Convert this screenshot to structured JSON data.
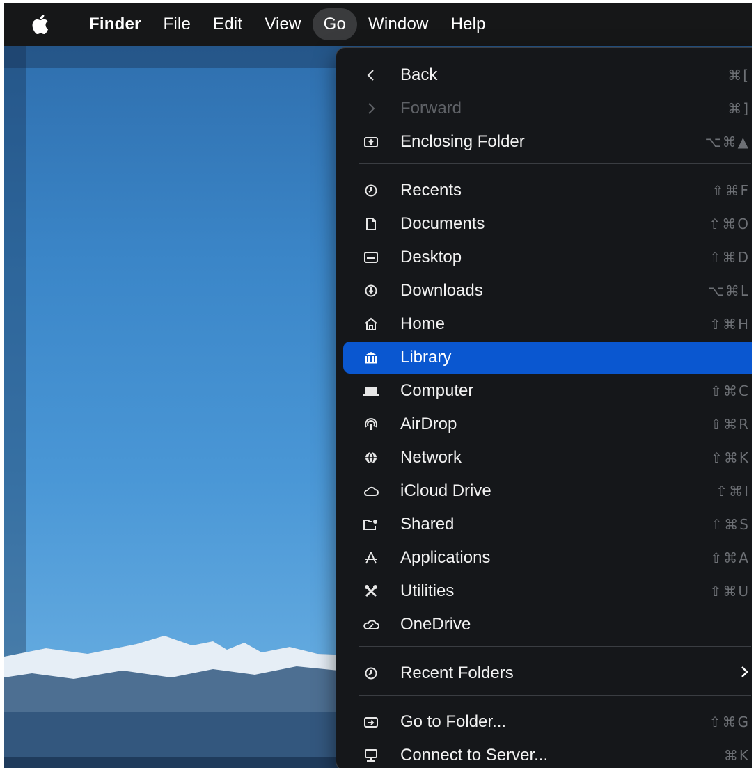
{
  "menubar": {
    "apple_icon": "apple-logo",
    "items": [
      "Finder",
      "File",
      "Edit",
      "View",
      "Go",
      "Window",
      "Help"
    ],
    "active": "Go"
  },
  "go_menu": {
    "items": [
      {
        "label": "Back",
        "icon": "chevron-left-icon",
        "shortcut": "⌘[",
        "enabled": true
      },
      {
        "label": "Forward",
        "icon": "chevron-right-icon",
        "shortcut": "⌘]",
        "enabled": false
      },
      {
        "label": "Enclosing Folder",
        "icon": "enclosing-folder-icon",
        "shortcut": "⌥⌘▲",
        "enabled": true
      },
      {
        "label": "Recents",
        "icon": "clock-icon",
        "shortcut": "⇧⌘F",
        "enabled": true
      },
      {
        "label": "Documents",
        "icon": "document-icon",
        "shortcut": "⇧⌘O",
        "enabled": true
      },
      {
        "label": "Desktop",
        "icon": "desktop-icon",
        "shortcut": "⇧⌘D",
        "enabled": true
      },
      {
        "label": "Downloads",
        "icon": "download-icon",
        "shortcut": "⌥⌘L",
        "enabled": true
      },
      {
        "label": "Home",
        "icon": "home-icon",
        "shortcut": "⇧⌘H",
        "enabled": true
      },
      {
        "label": "Library",
        "icon": "library-icon",
        "shortcut": "",
        "enabled": true,
        "highlighted": true
      },
      {
        "label": "Computer",
        "icon": "laptop-icon",
        "shortcut": "⇧⌘C",
        "enabled": true
      },
      {
        "label": "AirDrop",
        "icon": "airdrop-icon",
        "shortcut": "⇧⌘R",
        "enabled": true
      },
      {
        "label": "Network",
        "icon": "globe-icon",
        "shortcut": "⇧⌘K",
        "enabled": true
      },
      {
        "label": "iCloud Drive",
        "icon": "cloud-icon",
        "shortcut": "⇧⌘I",
        "enabled": true
      },
      {
        "label": "Shared",
        "icon": "shared-folder-icon",
        "shortcut": "⇧⌘S",
        "enabled": true
      },
      {
        "label": "Applications",
        "icon": "applications-icon",
        "shortcut": "⇧⌘A",
        "enabled": true
      },
      {
        "label": "Utilities",
        "icon": "utilities-icon",
        "shortcut": "⇧⌘U",
        "enabled": true
      },
      {
        "label": "OneDrive",
        "icon": "onedrive-icon",
        "shortcut": "",
        "enabled": true
      },
      {
        "label": "Recent Folders",
        "icon": "clock-icon",
        "shortcut": "",
        "submenu": true,
        "enabled": true
      },
      {
        "label": "Go to Folder...",
        "icon": "go-to-folder-icon",
        "shortcut": "⇧⌘G",
        "enabled": true
      },
      {
        "label": "Connect to Server...",
        "icon": "server-icon",
        "shortcut": "⌘K",
        "enabled": true
      }
    ]
  },
  "colors": {
    "menu_bg": "#15171a",
    "highlight": "#0a57d0",
    "menubar_bg": "#161718",
    "sky": "#3b86c8"
  }
}
